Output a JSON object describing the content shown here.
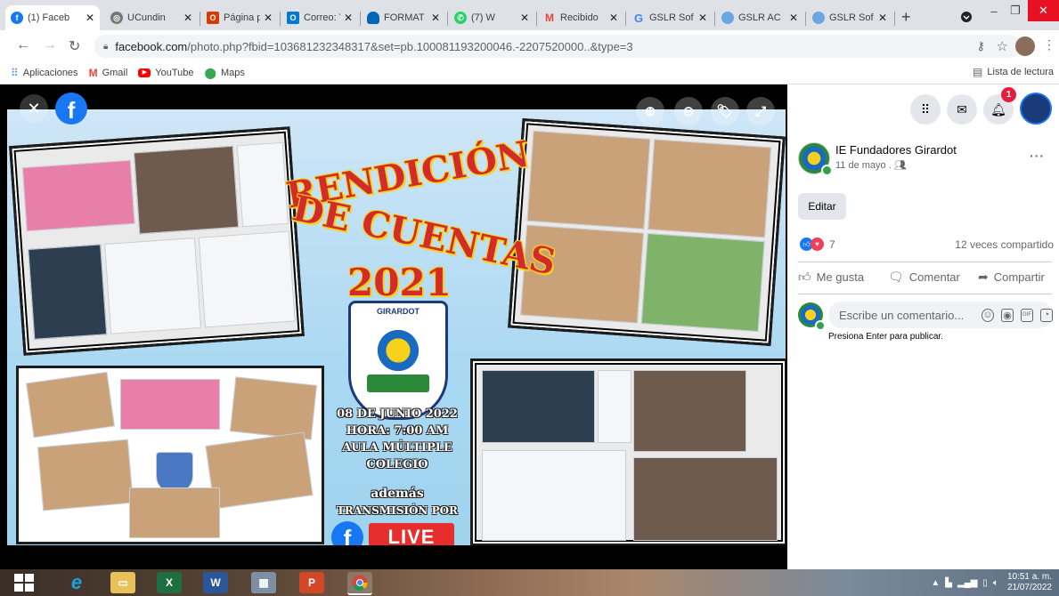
{
  "browser": {
    "tabs": [
      {
        "title": "(1) Faceb",
        "icon": "facebook-icon",
        "active": true
      },
      {
        "title": "UCundin",
        "icon": "ucundinamarca-icon"
      },
      {
        "title": "Página p",
        "icon": "office-icon"
      },
      {
        "title": "Correo: Y",
        "icon": "outlook-icon"
      },
      {
        "title": "FORMAT",
        "icon": "onedrive-icon"
      },
      {
        "title": "(7) W",
        "icon": "whatsapp-icon"
      },
      {
        "title": "Recibido",
        "icon": "gmail-icon"
      },
      {
        "title": "GSLR Sof",
        "icon": "google-icon"
      },
      {
        "title": "GSLR AC",
        "icon": "gslr-icon"
      },
      {
        "title": "GSLR Sof",
        "icon": "gslr-icon"
      }
    ],
    "new_tab_label": "+",
    "url_host": "facebook.com",
    "url_path": "/photo.php?fbid=103681232348317&set=pb.100081193200046.-2207520000..&type=3",
    "bookmarks": [
      {
        "label": "Aplicaciones",
        "icon": "apps-grid-icon"
      },
      {
        "label": "Gmail",
        "icon": "gmail-icon"
      },
      {
        "label": "YouTube",
        "icon": "youtube-icon"
      },
      {
        "label": "Maps",
        "icon": "maps-pin-icon"
      }
    ],
    "reading_list_label": "Lista de lectura"
  },
  "poster": {
    "title_line1": "RENDICIÓN",
    "title_line2": "DE CUENTAS",
    "title_year": "2021",
    "crest_name": "GIRARDOT",
    "event_date": "08 DE JUNIO 2022",
    "event_time": "HORA: 7:00 AM",
    "event_place1": "AULA MÚLTIPLE",
    "event_place2": "COLEGIO",
    "extra1": "además",
    "extra2": "TRANSMISIÓN POR",
    "live_label": "LIVE"
  },
  "post": {
    "page_name": "IE Fundadores Girardot",
    "date": "11 de mayo .",
    "edit_label": "Editar",
    "reaction_count": "7",
    "shares": "12 veces compartido",
    "like_label": "Me gusta",
    "comment_label": "Comentar",
    "share_label": "Compartir",
    "comment_placeholder": "Escribe un comentario...",
    "enter_hint": "Presiona Enter para publicar.",
    "notification_count": "1"
  },
  "taskbar": {
    "time": "10:51 a. m.",
    "date": "21/07/2022"
  },
  "colors": {
    "facebook_blue": "#1877f2",
    "poster_red": "#d12b2b",
    "poster_yellow": "#f7d21a"
  }
}
